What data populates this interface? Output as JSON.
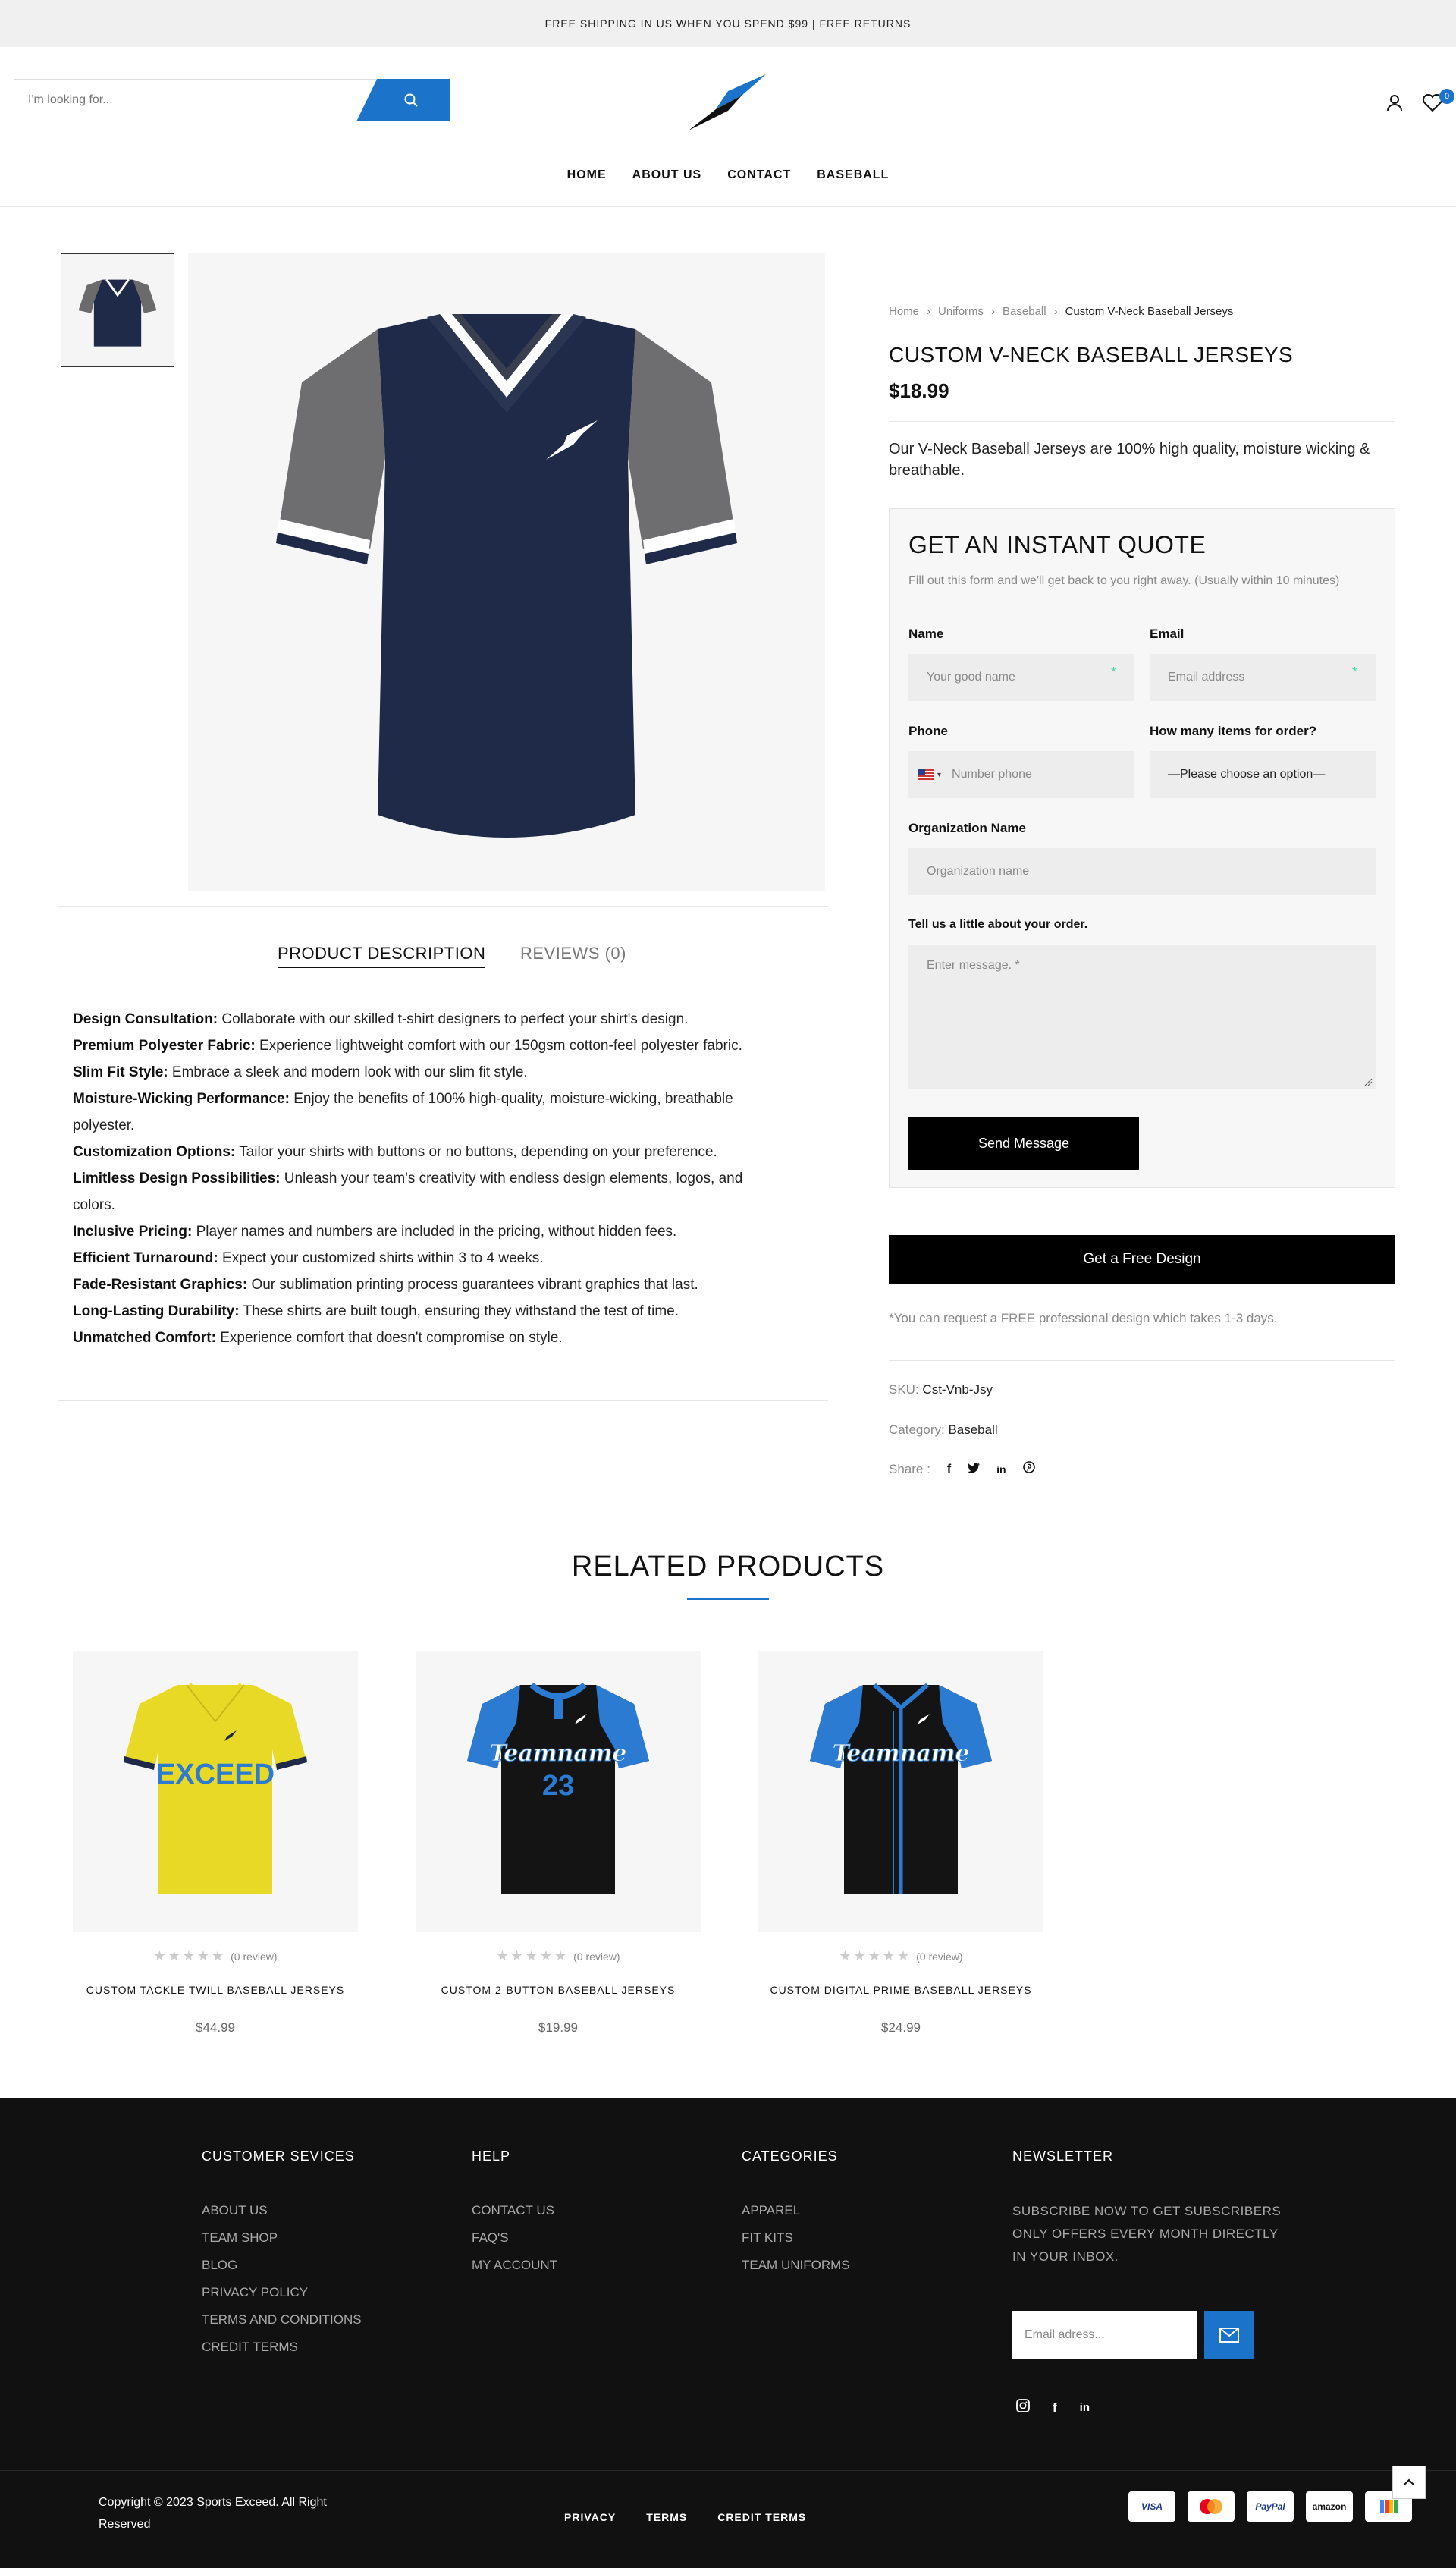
{
  "topbar": {
    "text": "FREE SHIPPING IN US WHEN YOU SPEND $99 | FREE RETURNS"
  },
  "header": {
    "search_placeholder": "I'm looking for...",
    "wishlist_count": "0",
    "nav": [
      "HOME",
      "ABOUT US",
      "CONTACT",
      "BASEBALL"
    ]
  },
  "breadcrumb": [
    "Home",
    "Uniforms",
    "Baseball",
    "Custom V-Neck Baseball Jerseys"
  ],
  "product": {
    "title": "CUSTOM V-NECK BASEBALL JERSEYS",
    "price": "$18.99",
    "short_desc": "Our V-Neck Baseball Jerseys are 100% high quality, moisture wicking & breathable.",
    "sku_label": "SKU:",
    "sku": "Cst-Vnb-Jsy",
    "category_label": "Category:",
    "category": "Baseball",
    "share_label": "Share :",
    "jersey_color": "#1e2a47"
  },
  "tabs": {
    "description": "PRODUCT DESCRIPTION",
    "reviews": "REVIEWS (0)"
  },
  "description": [
    {
      "b": "Design Consultation:",
      "t": " Collaborate with our skilled t-shirt designers to perfect your shirt's design."
    },
    {
      "b": "Premium Polyester Fabric:",
      "t": " Experience lightweight comfort with our 150gsm cotton-feel polyester fabric."
    },
    {
      "b": "Slim Fit Style:",
      "t": " Embrace a sleek and modern look with our slim fit style."
    },
    {
      "b": "Moisture-Wicking Performance:",
      "t": " Enjoy the benefits of 100% high-quality, moisture-wicking, breathable polyester."
    },
    {
      "b": "Customization Options:",
      "t": " Tailor your shirts with buttons or no buttons, depending on your preference."
    },
    {
      "b": "Limitless Design Possibilities:",
      "t": " Unleash your team's creativity with endless design elements, logos, and colors."
    },
    {
      "b": "Inclusive Pricing:",
      "t": " Player names and numbers are included in the pricing, without hidden fees."
    },
    {
      "b": "Efficient Turnaround:",
      "t": " Expect your customized shirts within 3 to 4 weeks."
    },
    {
      "b": "Fade-Resistant Graphics:",
      "t": " Our sublimation printing process guarantees vibrant graphics that last."
    },
    {
      "b": "Long-Lasting Durability:",
      "t": " These shirts are built tough, ensuring they withstand the test of time."
    },
    {
      "b": "Unmatched Comfort:",
      "t": " Experience comfort that doesn't compromise on style."
    }
  ],
  "quote": {
    "title": "GET AN INSTANT QUOTE",
    "subtitle": "Fill out this form and we'll get back to you right away. (Usually within 10 minutes)",
    "name_label": "Name",
    "name_placeholder": "Your good name",
    "email_label": "Email",
    "email_placeholder": "Email address",
    "phone_label": "Phone",
    "phone_placeholder": "Number phone",
    "qty_label": "How many items for order?",
    "qty_value": "—Please choose an option—",
    "org_label": "Organization Name",
    "org_placeholder": "Organization name",
    "msg_label": "Tell us a little about your order.",
    "msg_placeholder": "Enter message. *",
    "send": "Send Message"
  },
  "free_design": {
    "button": "Get a Free Design",
    "note": "*You can request a FREE professional design which takes 1-3 days."
  },
  "related": {
    "title": "RELATED PRODUCTS",
    "items": [
      {
        "name": "CUSTOM TACKLE TWILL BASEBALL JERSEYS",
        "price": "$44.99",
        "reviews": "(0 review)",
        "text": "EXCEED"
      },
      {
        "name": "CUSTOM 2-BUTTON BASEBALL JERSEYS",
        "price": "$19.99",
        "reviews": "(0 review)",
        "text": "Teamname",
        "number": "23"
      },
      {
        "name": "CUSTOM DIGITAL PRIME BASEBALL JERSEYS",
        "price": "$24.99",
        "reviews": "(0 review)",
        "text": "Teamname"
      }
    ]
  },
  "footer": {
    "col1": {
      "title": "CUSTOMER SEVICES",
      "items": [
        "ABOUT US",
        "TEAM SHOP",
        "BLOG",
        "PRIVACY POLICY",
        "TERMS AND CONDITIONS",
        "CREDIT TERMS"
      ]
    },
    "col2": {
      "title": "HELP",
      "items": [
        "CONTACT US",
        "FAQ'S",
        "MY ACCOUNT"
      ]
    },
    "col3": {
      "title": "CATEGORIES",
      "items": [
        "APPAREL",
        "FIT KITS",
        "TEAM UNIFORMS"
      ]
    },
    "newsletter": {
      "title": "NEWSLETTER",
      "text": "SUBSCRIBE NOW TO GET SUBSCRIBERS ONLY OFFERS EVERY MONTH DIRECTLY IN YOUR INBOX.",
      "placeholder": "Email adress..."
    },
    "copyright": "Copyright © 2023 Sports Exceed. All Right Reserved",
    "links": [
      "PRIVACY",
      "TERMS",
      "CREDIT TERMS"
    ],
    "payments": [
      "VISA",
      "mastercard",
      "PayPal",
      "amazon",
      "gpay"
    ]
  },
  "colors": {
    "accent": "#1b74c9",
    "footer_bg": "#111111"
  }
}
